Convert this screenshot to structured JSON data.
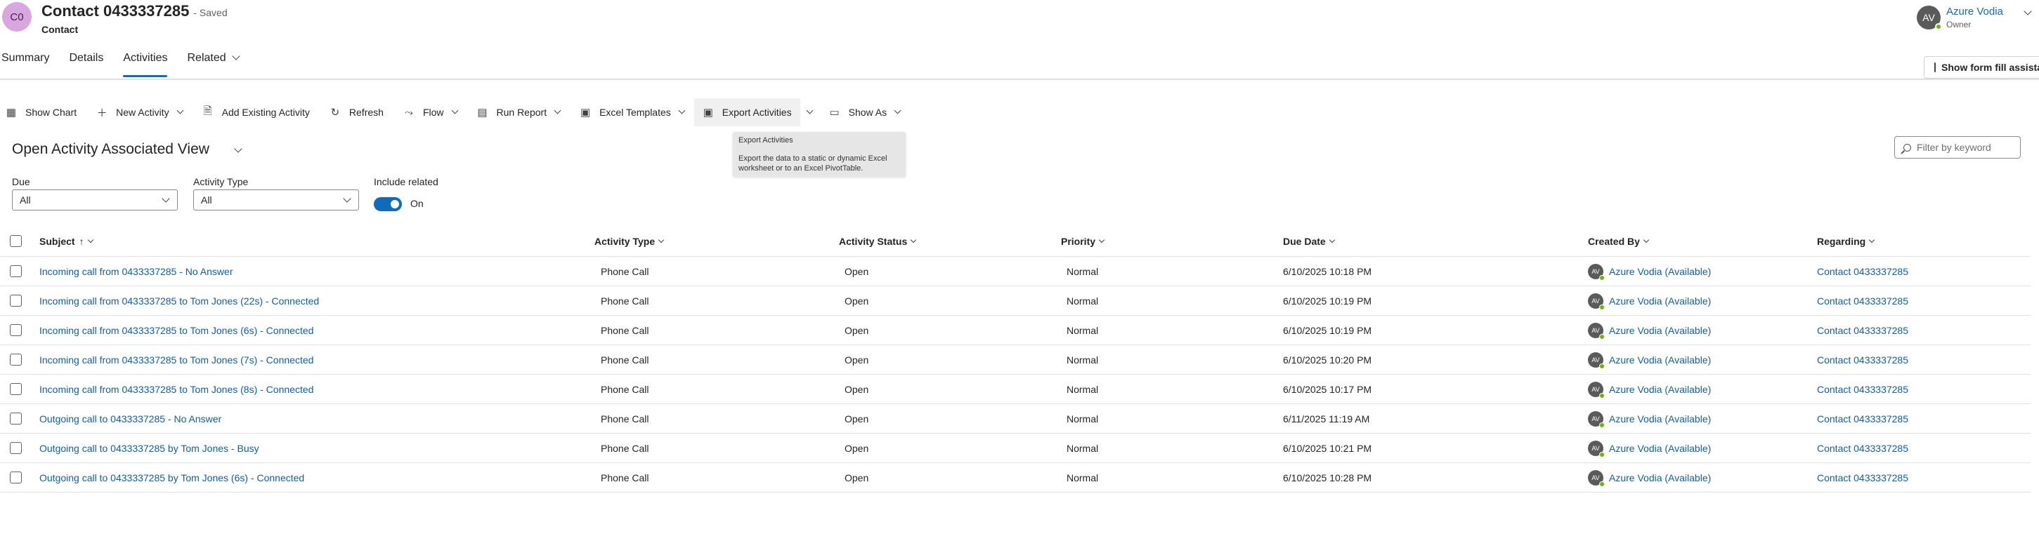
{
  "header": {
    "avatar_initials": "C0",
    "title": "Contact 0433337285",
    "saved_status": "- Saved",
    "entity_type": "Contact",
    "owner": {
      "initials": "AV",
      "name": "Azure Vodia",
      "role": "Owner"
    },
    "form_fill_label": "Show form fill assistant"
  },
  "tabs": [
    {
      "label": "Summary"
    },
    {
      "label": "Details"
    },
    {
      "label": "Activities",
      "active": true
    },
    {
      "label": "Related"
    }
  ],
  "commands": {
    "show_chart": "Show Chart",
    "new_activity": "New Activity",
    "add_existing": "Add Existing Activity",
    "refresh": "Refresh",
    "flow": "Flow",
    "run_report": "Run Report",
    "excel_templates": "Excel Templates",
    "export_activities": "Export Activities",
    "show_as": "Show As"
  },
  "tooltip": {
    "title": "Export Activities",
    "body": "Export the data to a static or dynamic Excel worksheet or to an Excel PivotTable."
  },
  "view": {
    "title": "Open Activity Associated View",
    "filter_placeholder": "Filter by keyword"
  },
  "filters": {
    "due": {
      "label": "Due",
      "value": "All"
    },
    "activity_type": {
      "label": "Activity Type",
      "value": "All"
    },
    "include_related": {
      "label": "Include related",
      "state": "On"
    }
  },
  "grid": {
    "columns": {
      "subject": "Subject",
      "sort_indicator": "↑",
      "activity_type": "Activity Type",
      "activity_status": "Activity Status",
      "priority": "Priority",
      "due_date": "Due Date",
      "created_by": "Created By",
      "regarding": "Regarding"
    },
    "rows": [
      {
        "subject": "Incoming call from 0433337285 - No Answer",
        "type": "Phone Call",
        "status": "Open",
        "priority": "Normal",
        "due": "6/10/2025 10:18 PM",
        "created_by": "Azure Vodia (Available)",
        "regarding": "Contact 0433337285"
      },
      {
        "subject": "Incoming call from 0433337285 to Tom Jones (22s) - Connected",
        "type": "Phone Call",
        "status": "Open",
        "priority": "Normal",
        "due": "6/10/2025 10:19 PM",
        "created_by": "Azure Vodia (Available)",
        "regarding": "Contact 0433337285"
      },
      {
        "subject": "Incoming call from 0433337285 to Tom Jones (6s) - Connected",
        "type": "Phone Call",
        "status": "Open",
        "priority": "Normal",
        "due": "6/10/2025 10:19 PM",
        "created_by": "Azure Vodia (Available)",
        "regarding": "Contact 0433337285"
      },
      {
        "subject": "Incoming call from 0433337285 to Tom Jones (7s) - Connected",
        "type": "Phone Call",
        "status": "Open",
        "priority": "Normal",
        "due": "6/10/2025 10:20 PM",
        "created_by": "Azure Vodia (Available)",
        "regarding": "Contact 0433337285"
      },
      {
        "subject": "Incoming call from 0433337285 to Tom Jones (8s) - Connected",
        "type": "Phone Call",
        "status": "Open",
        "priority": "Normal",
        "due": "6/10/2025 10:17 PM",
        "created_by": "Azure Vodia (Available)",
        "regarding": "Contact 0433337285"
      },
      {
        "subject": "Outgoing call to 0433337285 - No Answer",
        "type": "Phone Call",
        "status": "Open",
        "priority": "Normal",
        "due": "6/11/2025 11:19 AM",
        "created_by": "Azure Vodia (Available)",
        "regarding": "Contact 0433337285"
      },
      {
        "subject": "Outgoing call to 0433337285 by Tom Jones - Busy",
        "type": "Phone Call",
        "status": "Open",
        "priority": "Normal",
        "due": "6/10/2025 10:21 PM",
        "created_by": "Azure Vodia (Available)",
        "regarding": "Contact 0433337285"
      },
      {
        "subject": "Outgoing call to 0433337285 by Tom Jones (6s) - Connected",
        "type": "Phone Call",
        "status": "Open",
        "priority": "Normal",
        "due": "6/10/2025 10:28 PM",
        "created_by": "Azure Vodia (Available)",
        "regarding": "Contact 0433337285"
      }
    ]
  },
  "colors": {
    "accent": "#0f6cbd",
    "link": "#115ea3",
    "presence": "#6bb700",
    "avatar_contact": "#d9a6e0"
  }
}
